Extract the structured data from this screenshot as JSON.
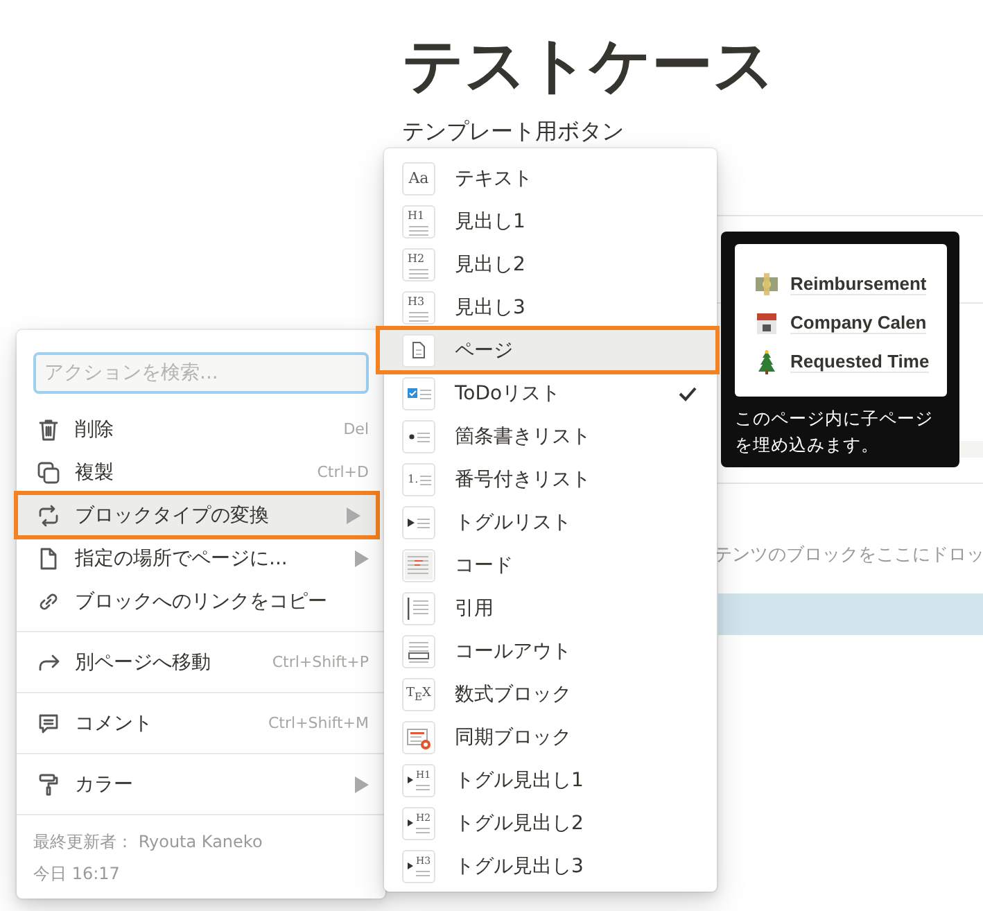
{
  "page": {
    "title": "テストケース",
    "subtitle": "テンプレート用ボタン",
    "drop_hint": "テンツのブロックをここにドロッ"
  },
  "action_menu": {
    "search": {
      "placeholder": "アクションを検索..."
    },
    "groups": [
      [
        {
          "kind": "trash",
          "label": "削除",
          "shortcut": "Del",
          "submenu": false,
          "selected": false
        },
        {
          "kind": "duplicate",
          "label": "複製",
          "shortcut": "Ctrl+D",
          "submenu": false,
          "selected": false
        },
        {
          "kind": "convert",
          "label": "ブロックタイプの変換",
          "submenu": true,
          "selected": true
        },
        {
          "kind": "page",
          "label": "指定の場所でページに...",
          "submenu": true,
          "selected": false
        },
        {
          "kind": "link",
          "label": "ブロックへのリンクをコピー",
          "submenu": false,
          "selected": false
        }
      ],
      [
        {
          "kind": "move",
          "label": "別ページへ移動",
          "shortcut": "Ctrl+Shift+P",
          "submenu": false,
          "selected": false
        }
      ],
      [
        {
          "kind": "comment",
          "label": "コメント",
          "shortcut": "Ctrl+Shift+M",
          "submenu": false,
          "selected": false
        }
      ],
      [
        {
          "kind": "paint",
          "label": "カラー",
          "submenu": true,
          "selected": false
        }
      ]
    ],
    "footer": [
      "最終更新者： Ryouta Kaneko",
      "今日 16:17"
    ]
  },
  "block_menu": [
    {
      "kind": "text",
      "icon_text": "Aa",
      "label": "テキスト",
      "selected": false,
      "checked": false
    },
    {
      "kind": "heading",
      "icon_text": "H1",
      "label": "見出し1",
      "selected": false,
      "checked": false
    },
    {
      "kind": "heading",
      "icon_text": "H2",
      "label": "見出し2",
      "selected": false,
      "checked": false
    },
    {
      "kind": "heading",
      "icon_text": "H3",
      "label": "見出し3",
      "selected": false,
      "checked": false
    },
    {
      "kind": "page",
      "label": "ページ",
      "selected": true,
      "checked": false
    },
    {
      "kind": "todo",
      "label": "ToDoリスト",
      "selected": false,
      "checked": true
    },
    {
      "kind": "bullet",
      "label": "箇条書きリスト",
      "selected": false,
      "checked": false
    },
    {
      "kind": "number",
      "icon_text": "1.",
      "label": "番号付きリスト",
      "selected": false,
      "checked": false
    },
    {
      "kind": "toggle",
      "label": "トグルリスト",
      "selected": false,
      "checked": false
    },
    {
      "kind": "code",
      "label": "コード",
      "selected": false,
      "checked": false
    },
    {
      "kind": "quote",
      "label": "引用",
      "selected": false,
      "checked": false
    },
    {
      "kind": "callout",
      "label": "コールアウト",
      "selected": false,
      "checked": false
    },
    {
      "kind": "tex",
      "icon_text": "T$_{E}$X",
      "label": "数式ブロック",
      "selected": false,
      "checked": false
    },
    {
      "kind": "sync",
      "label": "同期ブロック",
      "selected": false,
      "checked": false
    },
    {
      "kind": "toggle_heading",
      "icon_text": "H1",
      "label": "トグル見出し1",
      "selected": false,
      "checked": false
    },
    {
      "kind": "toggle_heading",
      "icon_text": "H2",
      "label": "トグル見出し2",
      "selected": false,
      "checked": false
    },
    {
      "kind": "toggle_heading",
      "icon_text": "H3",
      "label": "トグル見出し3",
      "selected": false,
      "checked": false
    }
  ],
  "tooltip": {
    "preview": [
      {
        "kind": "money",
        "label": "Reimbursement"
      },
      {
        "kind": "calendar",
        "label": "Company Calen"
      },
      {
        "kind": "tree",
        "label": "Requested Time"
      }
    ],
    "text": "このページ内に子ページを埋め込みます。"
  }
}
